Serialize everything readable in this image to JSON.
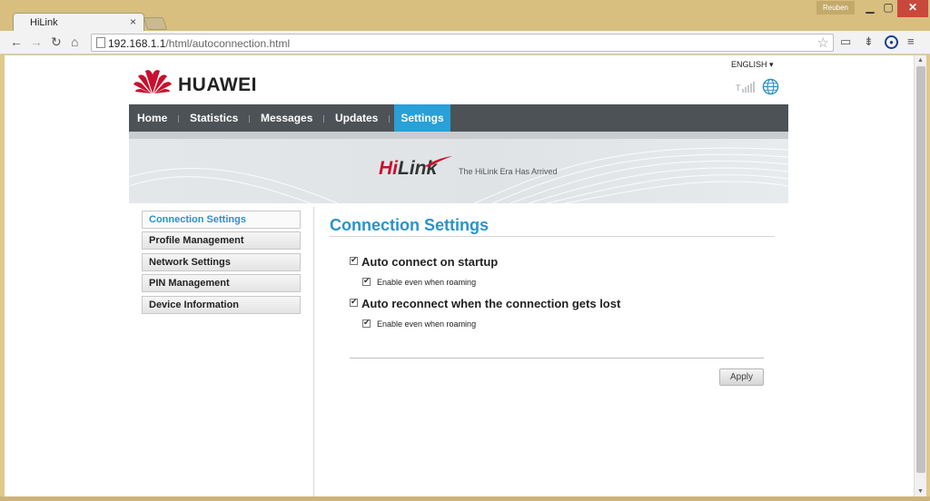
{
  "browser": {
    "tab_title": "HiLink",
    "tab_close": "×",
    "profile_name": "Reuben",
    "url_host": "192.168.1.1",
    "url_path": "/html/autoconnection.html"
  },
  "header": {
    "brand": "HUAWEI",
    "language": "ENGLISH ▾"
  },
  "navbar": {
    "items": [
      "Home",
      "Statistics",
      "Messages",
      "Updates",
      "Settings"
    ],
    "active": "Settings"
  },
  "banner": {
    "logo_hi": "Hi",
    "logo_link": "Link",
    "tagline": "The HiLink Era Has Arrived"
  },
  "sidebar": {
    "items": [
      "Connection Settings",
      "Profile Management",
      "Network Settings",
      "PIN Management",
      "Device Information"
    ],
    "active": "Connection Settings"
  },
  "content": {
    "title": "Connection Settings",
    "options": [
      {
        "label": "Auto connect on startup",
        "checked": true,
        "sub_label": "Enable even when roaming",
        "sub_checked": true
      },
      {
        "label": "Auto reconnect when the connection gets lost",
        "checked": true,
        "sub_label": "Enable even when roaming",
        "sub_checked": true
      }
    ],
    "apply_label": "Apply"
  },
  "colors": {
    "accent": "#29a0d8",
    "navbar": "#4c5256",
    "huawei_red": "#c8102e"
  }
}
